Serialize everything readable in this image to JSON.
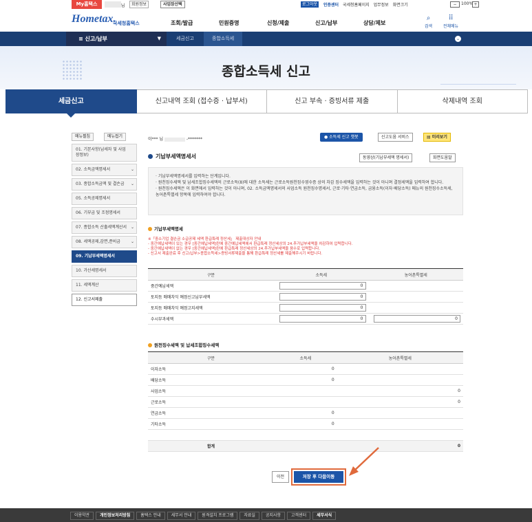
{
  "util": {
    "my_hometax": "My홈택스",
    "nim": "님",
    "member_info": "회원정보",
    "business_select": "사업장선택",
    "logout": "로그아웃",
    "auth_center": "인증센터",
    "links": [
      "국세청홈페이지",
      "업무정보",
      "화면크기"
    ],
    "zoom_minus": "−",
    "zoom_value": "100%",
    "zoom_plus": "+"
  },
  "header": {
    "logo": "Hometax.",
    "logo_sub": "국세청홈택스",
    "gnb": [
      "조회/발급",
      "민원증명",
      "신청/제출",
      "신고/납부",
      "상담/제보"
    ],
    "search_label": "검색",
    "allmenu_label": "전체메뉴",
    "search_icon": "search-icon",
    "allmenu_icon": "grid-icon"
  },
  "nav": {
    "menu": "신고/납부",
    "crumb1": "세금신고",
    "crumb2": "종합소득세"
  },
  "hero": {
    "title": "종합소득세 신고"
  },
  "tabs": [
    "세금신고",
    "신고내역 조회 (접수증 · 납부서)",
    "신고 부속 · 증빙서류 제출",
    "삭제내역 조회"
  ],
  "sidebar": {
    "expand": "메뉴펼침",
    "collapse": "메뉴접기",
    "items": [
      "01. 기본사항(납세자 및 사업장정보)",
      "02. 소득금액명세서",
      "03. 종합소득금액 및 결손금",
      "05. 소득공제명세서",
      "06. 기부금 및 조정명세서",
      "07. 종합소득 산출세액계산서",
      "08. 세액공제,감면,준비금",
      "09. 기납부세액명세서",
      "10. 가산세명세서",
      "11. 세액계산",
      "12. 신고서제출"
    ]
  },
  "content": {
    "user_prefix": "이***",
    "user_nim": "님",
    "user_mask": "-*******",
    "chatbot": "소득세 신고 챗봇",
    "help_service": "신고도움 서비스",
    "preview": "미리보기",
    "section_title": "기납부세액명세서",
    "video_btn": "동영상(기납부세액 명세서)",
    "screen_help_btn": "화면도움말",
    "info": [
      "· 기납부세액명세서를 입력하는 단계입니다.",
      "· 원천징수세액 및 납세조합징수세액의 근로소득(8)에 대한 소득세는 근로소득원천징수영수증 상의 차감 징수세액을 입력하는 것이 아니며 결정세액을 입력하여 합니다.",
      "· 원천징수세액은 이 화면에서 입력하는 것이 아니며, 02. 소득금액명세서의 사업소득 원천징수명세서, 근로·기타·연금소득, 금융소득(이자·배당소득) 메뉴의 원천징수소득세, 농어촌특별세 항목에 입력하여야 합니다."
    ],
    "sub1_title": "기납부세액명세",
    "notice": [
      "※「중소기업 결손금 소급공제 세액 환급특례 정산세」 제출대상자 안내",
      " - 중간예납세액이 있는 경우 [중간예납세액]란에 중간예납세액에서 환급특례 정산세상의 24.추가납부세액을 차감하여 입력합니다.",
      " - 중간예납세액이 없는 경우 [중간예납세액]란에 환급특례 정산세상의 24.추가납부세액을 음수로 입력합니다.",
      " - 신고서 제출완료 후 신고/납부>종합소득세>증빙서류제출을 통해 환급특례 정산세를 제출해주시기 바랍니다."
    ],
    "table1": {
      "headers": [
        "구분",
        "소득세",
        "농어촌특별세"
      ],
      "rows": [
        {
          "label": "중간예납세액",
          "tax": "0",
          "rural": ""
        },
        {
          "label": "토지등 매매차익 예정신고납부세액",
          "tax": "0",
          "rural": ""
        },
        {
          "label": "토지등 매매차익 예정고지세액",
          "tax": "0",
          "rural": ""
        },
        {
          "label": "수시부과세액",
          "tax": "0",
          "rural": "0"
        }
      ]
    },
    "sub2_title": "원천징수세액 및 납세조합징수세액",
    "table2": {
      "headers": [
        "구분",
        "소득세",
        "농어촌특별세"
      ],
      "rows": [
        {
          "label": "이자소득",
          "tax": "0",
          "rural": ""
        },
        {
          "label": "배당소득",
          "tax": "0",
          "rural": ""
        },
        {
          "label": "사업소득",
          "tax": "",
          "rural": "0"
        },
        {
          "label": "근로소득",
          "tax": "",
          "rural": "0"
        },
        {
          "label": "연금소득",
          "tax": "0",
          "rural": ""
        },
        {
          "label": "기타소득",
          "tax": "0",
          "rural": ""
        },
        {
          "label": "",
          "tax": "",
          "rural": ""
        }
      ],
      "total_label": "합계",
      "total_rural": "0"
    },
    "prev_btn": "이전",
    "save_btn": "저장 후 다음이동"
  },
  "footer": {
    "links": [
      "이용약관",
      "개인정보처리방침",
      "홈택스 안내",
      "세무서 안내",
      "원격설치 프로그램",
      "자료실",
      "공지사항",
      "고객센터",
      "세무서식"
    ]
  },
  "colors": {
    "accent": "#1f4a8a",
    "brand_red": "#e8473f",
    "highlight": "#e06a3c"
  }
}
